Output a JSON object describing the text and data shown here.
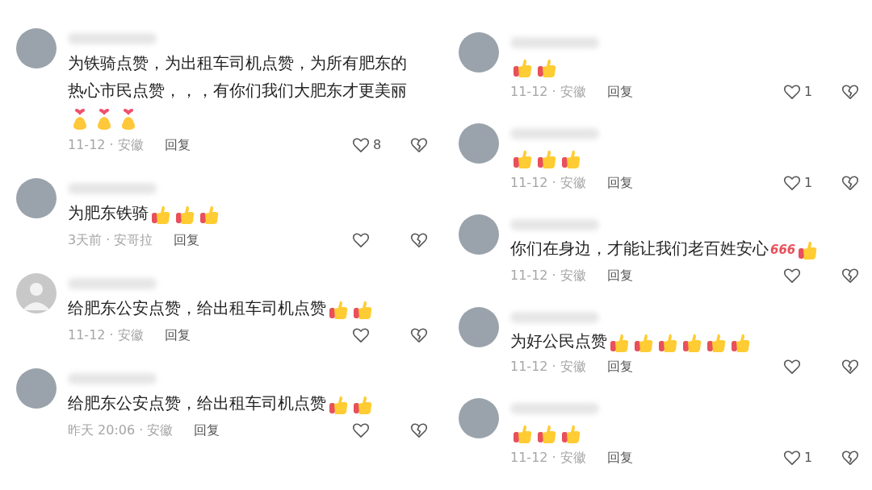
{
  "columns": [
    {
      "comments": [
        {
          "avatar": {
            "kind": "photo"
          },
          "text": "为铁骑点赞，为出租车司机点赞，为所有肥东的热心市民点赞，，，有你们我们大肥东才更美丽",
          "emojis": [
            {
              "kind": "finger_heart"
            },
            {
              "kind": "finger_heart"
            },
            {
              "kind": "finger_heart"
            }
          ],
          "meta": "11-12 · 安徽",
          "reply": "回复",
          "likes": "8"
        },
        {
          "avatar": {
            "kind": "photo"
          },
          "text": "为肥东铁骑",
          "emojis": [
            {
              "kind": "thumbs_up"
            },
            {
              "kind": "thumbs_up"
            },
            {
              "kind": "thumbs_up"
            }
          ],
          "meta": "3天前 · 安哥拉",
          "reply": "回复"
        },
        {
          "avatar": {
            "kind": "default"
          },
          "text": "给肥东公安点赞，给出租车司机点赞",
          "emojis": [
            {
              "kind": "thumbs_up"
            },
            {
              "kind": "thumbs_up"
            }
          ],
          "meta": "11-12 · 安徽",
          "reply": "回复"
        },
        {
          "avatar": {
            "kind": "photo"
          },
          "text": "给肥东公安点赞，给出租车司机点赞",
          "emojis": [
            {
              "kind": "thumbs_up"
            },
            {
              "kind": "thumbs_up"
            }
          ],
          "meta": "昨天 20:06 · 安徽",
          "reply": "回复"
        }
      ]
    },
    {
      "comments": [
        {
          "avatar": {
            "kind": "photo"
          },
          "emojis": [
            {
              "kind": "thumbs_up"
            },
            {
              "kind": "thumbs_up"
            }
          ],
          "meta": "11-12 · 安徽",
          "reply": "回复",
          "likes": "1"
        },
        {
          "avatar": {
            "kind": "photo"
          },
          "emojis": [
            {
              "kind": "thumbs_up"
            },
            {
              "kind": "thumbs_up"
            },
            {
              "kind": "thumbs_up"
            }
          ],
          "meta": "11-12 · 安徽",
          "reply": "回复",
          "likes": "1"
        },
        {
          "avatar": {
            "kind": "photo"
          },
          "text": "你们在身边，才能让我们老百姓安心",
          "badge": "666",
          "emojis": [
            {
              "kind": "thumbs_up"
            }
          ],
          "meta": "11-12 · 安徽",
          "reply": "回复"
        },
        {
          "avatar": {
            "kind": "photo"
          },
          "text": "为好公民点赞",
          "emojis": [
            {
              "kind": "thumbs_up"
            },
            {
              "kind": "thumbs_up"
            },
            {
              "kind": "thumbs_up"
            },
            {
              "kind": "thumbs_up"
            },
            {
              "kind": "thumbs_up"
            },
            {
              "kind": "thumbs_up"
            }
          ],
          "meta": "11-12 · 安徽",
          "reply": "回复"
        },
        {
          "avatar": {
            "kind": "photo"
          },
          "emojis": [
            {
              "kind": "thumbs_up"
            },
            {
              "kind": "thumbs_up"
            },
            {
              "kind": "thumbs_up"
            }
          ],
          "meta": "11-12 · 安徽",
          "reply": "回复",
          "likes": "1"
        }
      ]
    }
  ]
}
